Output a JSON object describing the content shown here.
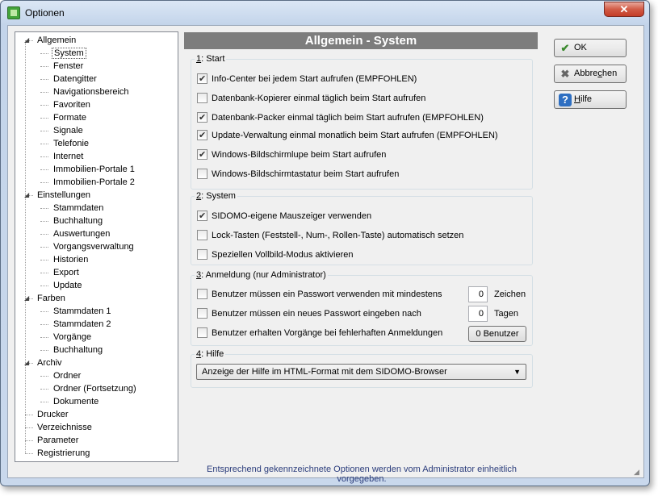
{
  "window": {
    "title": "Optionen",
    "close_label": "✕"
  },
  "tree": [
    {
      "label": "Allgemein",
      "level": 0,
      "expanded": true
    },
    {
      "label": "System",
      "level": 1,
      "selected": true
    },
    {
      "label": "Fenster",
      "level": 1
    },
    {
      "label": "Datengitter",
      "level": 1
    },
    {
      "label": "Navigationsbereich",
      "level": 1
    },
    {
      "label": "Favoriten",
      "level": 1
    },
    {
      "label": "Formate",
      "level": 1
    },
    {
      "label": "Signale",
      "level": 1
    },
    {
      "label": "Telefonie",
      "level": 1
    },
    {
      "label": "Internet",
      "level": 1
    },
    {
      "label": "Immobilien-Portale 1",
      "level": 1
    },
    {
      "label": "Immobilien-Portale 2",
      "level": 1
    },
    {
      "label": "Einstellungen",
      "level": 0,
      "expanded": true
    },
    {
      "label": "Stammdaten",
      "level": 1
    },
    {
      "label": "Buchhaltung",
      "level": 1
    },
    {
      "label": "Auswertungen",
      "level": 1
    },
    {
      "label": "Vorgangsverwaltung",
      "level": 1
    },
    {
      "label": "Historien",
      "level": 1
    },
    {
      "label": "Export",
      "level": 1
    },
    {
      "label": "Update",
      "level": 1
    },
    {
      "label": "Farben",
      "level": 0,
      "expanded": true
    },
    {
      "label": "Stammdaten 1",
      "level": 1
    },
    {
      "label": "Stammdaten 2",
      "level": 1
    },
    {
      "label": "Vorgänge",
      "level": 1
    },
    {
      "label": "Buchhaltung",
      "level": 1
    },
    {
      "label": "Archiv",
      "level": 0,
      "expanded": true
    },
    {
      "label": "Ordner",
      "level": 1
    },
    {
      "label": "Ordner (Fortsetzung)",
      "level": 1
    },
    {
      "label": "Dokumente",
      "level": 1
    },
    {
      "label": "Drucker",
      "level": 0
    },
    {
      "label": "Verzeichnisse",
      "level": 0
    },
    {
      "label": "Parameter",
      "level": 0
    },
    {
      "label": "Registrierung",
      "level": 0
    }
  ],
  "header": {
    "title": "Allgemein - System"
  },
  "sections": {
    "start": {
      "key": "1",
      "legend": ": Start",
      "options": [
        {
          "label": "Info-Center bei jedem Start aufrufen (EMPFOHLEN)",
          "checked": true
        },
        {
          "label": "Datenbank-Kopierer einmal täglich beim Start aufrufen",
          "checked": false
        },
        {
          "label": "Datenbank-Packer einmal täglich beim Start aufrufen (EMPFOHLEN)",
          "checked": true
        },
        {
          "label": "Update-Verwaltung einmal monatlich beim Start aufrufen (EMPFOHLEN)",
          "checked": true
        },
        {
          "label": "Windows-Bildschirmlupe beim Start aufrufen",
          "checked": true
        },
        {
          "label": "Windows-Bildschirmtastatur beim Start aufrufen",
          "checked": false
        }
      ]
    },
    "system": {
      "key": "2",
      "legend": ": System",
      "options": [
        {
          "label": "SIDOMO-eigene Mauszeiger verwenden",
          "checked": true
        },
        {
          "label": "Lock-Tasten (Feststell-, Num-, Rollen-Taste) automatisch setzen",
          "checked": false
        },
        {
          "label": "Speziellen Vollbild-Modus aktivieren",
          "checked": false
        }
      ]
    },
    "anmeldung": {
      "key": "3",
      "legend": ": Anmeldung  (nur Administrator)",
      "password_min": {
        "label": "Benutzer müssen ein Passwort verwenden mit mindestens",
        "checked": false,
        "value": "0",
        "unit": "Zeichen"
      },
      "password_change": {
        "label": "Benutzer müssen ein neues Passwort eingeben nach",
        "checked": false,
        "value": "0",
        "unit": "Tagen"
      },
      "failed_logins": {
        "label": "Benutzer erhalten Vorgänge bei fehlerhaften Anmeldungen",
        "checked": false,
        "button": "0 Benutzer"
      }
    },
    "hilfe": {
      "key": "4",
      "legend": ": Hilfe",
      "selected": "Anzeige der Hilfe im HTML-Format mit dem SIDOMO-Browser"
    }
  },
  "buttons": {
    "ok": "OK",
    "cancel_pre": "Abbre",
    "cancel_u": "c",
    "cancel_post": "hen",
    "help_u": "H",
    "help_post": "ilfe"
  },
  "footer": "Entsprechend gekennzeichnete Optionen werden vom Administrator einheitlich vorgegeben."
}
